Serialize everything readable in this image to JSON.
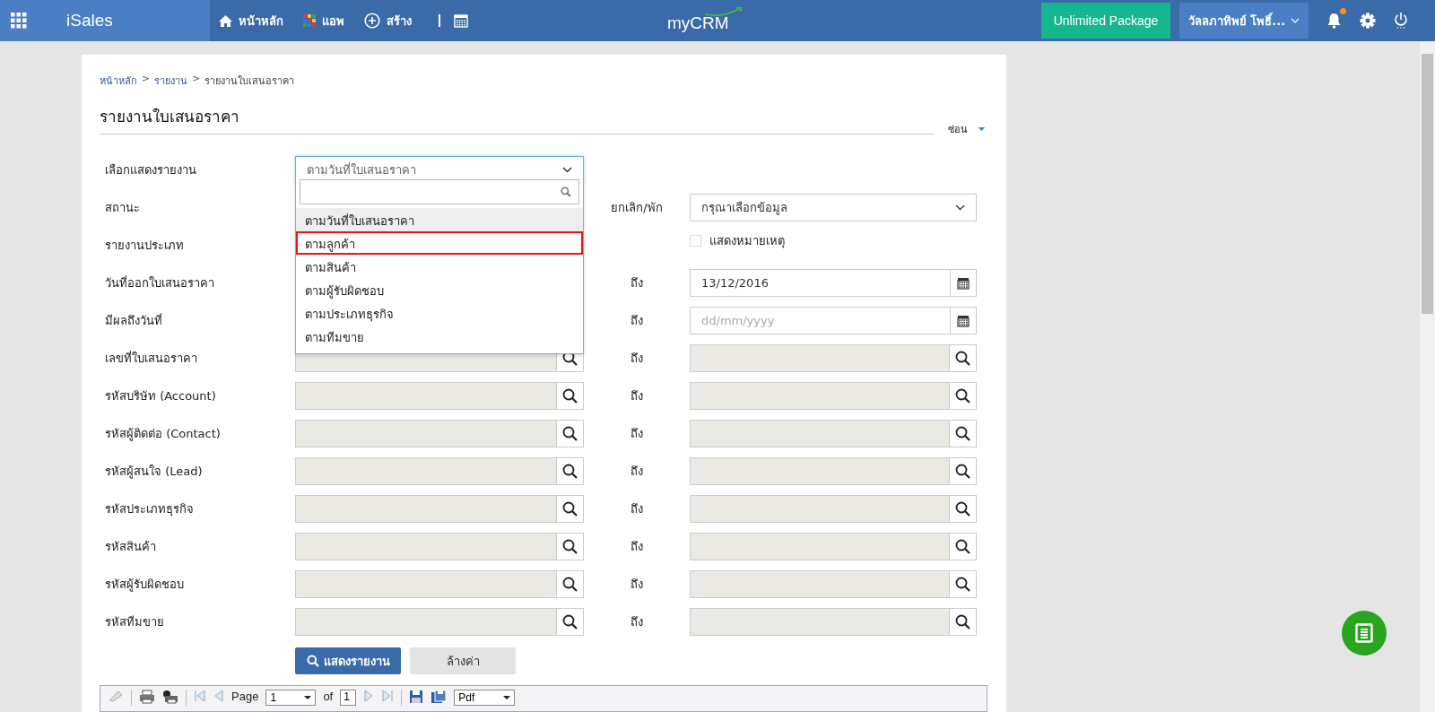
{
  "header": {
    "app_name": "iSales",
    "nav": [
      {
        "kind": "home",
        "label": "หน้าหลัก"
      },
      {
        "kind": "apps",
        "label": "แอพ"
      },
      {
        "kind": "create",
        "label": "สร้าง"
      },
      {
        "kind": "calendar"
      }
    ],
    "logo": "myCRM",
    "package_button": "Unlimited Package",
    "user": "วัลลภาทิพย์ โพธิ์...",
    "notification_badge": true
  },
  "breadcrumb": {
    "separator": ">",
    "items": [
      "หน้าหลัก",
      "รายงาน",
      "รายงานใบเสนอราคา"
    ]
  },
  "title": "รายงานใบเสนอราคา",
  "collapse_link": "ซ่อน",
  "form": [
    {
      "label": "เลือกแสดงรายงาน",
      "left": {
        "kind": "select",
        "value": "ตามวันที่ใบเสนอราคา"
      }
    },
    {
      "label": "สถานะ",
      "right_label": "ยกเลิก/พัก",
      "right": {
        "kind": "select",
        "value": "กรุณาเลือกข้อมูล"
      }
    },
    {
      "label": "รายงานประเภท",
      "right": {
        "kind": "checkbox",
        "label": "แสดงหมายเหตุ",
        "checked": false
      }
    },
    {
      "label": "วันที่ออกใบเสนอราคา",
      "right_label": "ถึง",
      "right": {
        "kind": "date",
        "value": "13/12/2016"
      }
    },
    {
      "label": "มีผลถึงวันที่",
      "right_label": "ถึง",
      "right": {
        "kind": "date",
        "placeholder": "dd/mm/yyyy"
      }
    },
    {
      "label": "เลขที่ใบเสนอราคา",
      "left": {
        "kind": "lookup"
      },
      "right_label": "ถึง",
      "right": {
        "kind": "lookup"
      }
    },
    {
      "label": "รหัสบริษัท (Account)",
      "left": {
        "kind": "lookup"
      },
      "right_label": "ถึง",
      "right": {
        "kind": "lookup"
      }
    },
    {
      "label": "รหัสผู้ติดต่อ (Contact)",
      "left": {
        "kind": "lookup"
      },
      "right_label": "ถึง",
      "right": {
        "kind": "lookup"
      }
    },
    {
      "label": "รหัสผู้สนใจ (Lead)",
      "left": {
        "kind": "lookup"
      },
      "right_label": "ถึง",
      "right": {
        "kind": "lookup"
      }
    },
    {
      "label": "รหัสประเภทธุรกิจ",
      "left": {
        "kind": "lookup"
      },
      "right_label": "ถึง",
      "right": {
        "kind": "lookup"
      }
    },
    {
      "label": "รหัสสินค้า",
      "left": {
        "kind": "lookup"
      },
      "right_label": "ถึง",
      "right": {
        "kind": "lookup"
      }
    },
    {
      "label": "รหัสผู้รับผิดชอบ",
      "left": {
        "kind": "lookup"
      },
      "right_label": "ถึง",
      "right": {
        "kind": "lookup"
      }
    },
    {
      "label": "รหัสทีมขาย",
      "left": {
        "kind": "lookup"
      },
      "right_label": "ถึง",
      "right": {
        "kind": "lookup"
      }
    }
  ],
  "dropdown": {
    "options": [
      {
        "label": "ตามวันที่ใบเสนอราคา",
        "selected": true,
        "outlined": false
      },
      {
        "label": "ตามลูกค้า",
        "selected": false,
        "outlined": true
      },
      {
        "label": "ตามสินค้า",
        "selected": false,
        "outlined": false
      },
      {
        "label": "ตามผู้รับผิดชอบ",
        "selected": false,
        "outlined": false
      },
      {
        "label": "ตามประเภทธุรกิจ",
        "selected": false,
        "outlined": false
      },
      {
        "label": "ตามทีมขาย",
        "selected": false,
        "outlined": false
      }
    ]
  },
  "buttons": {
    "show_report": "แสดงรายงาน",
    "clear": "ล้างค่า"
  },
  "viewer_toolbar": {
    "page_label": "Page",
    "page_value": "1",
    "of_label": "of",
    "page_total": "1",
    "format": "Pdf"
  }
}
